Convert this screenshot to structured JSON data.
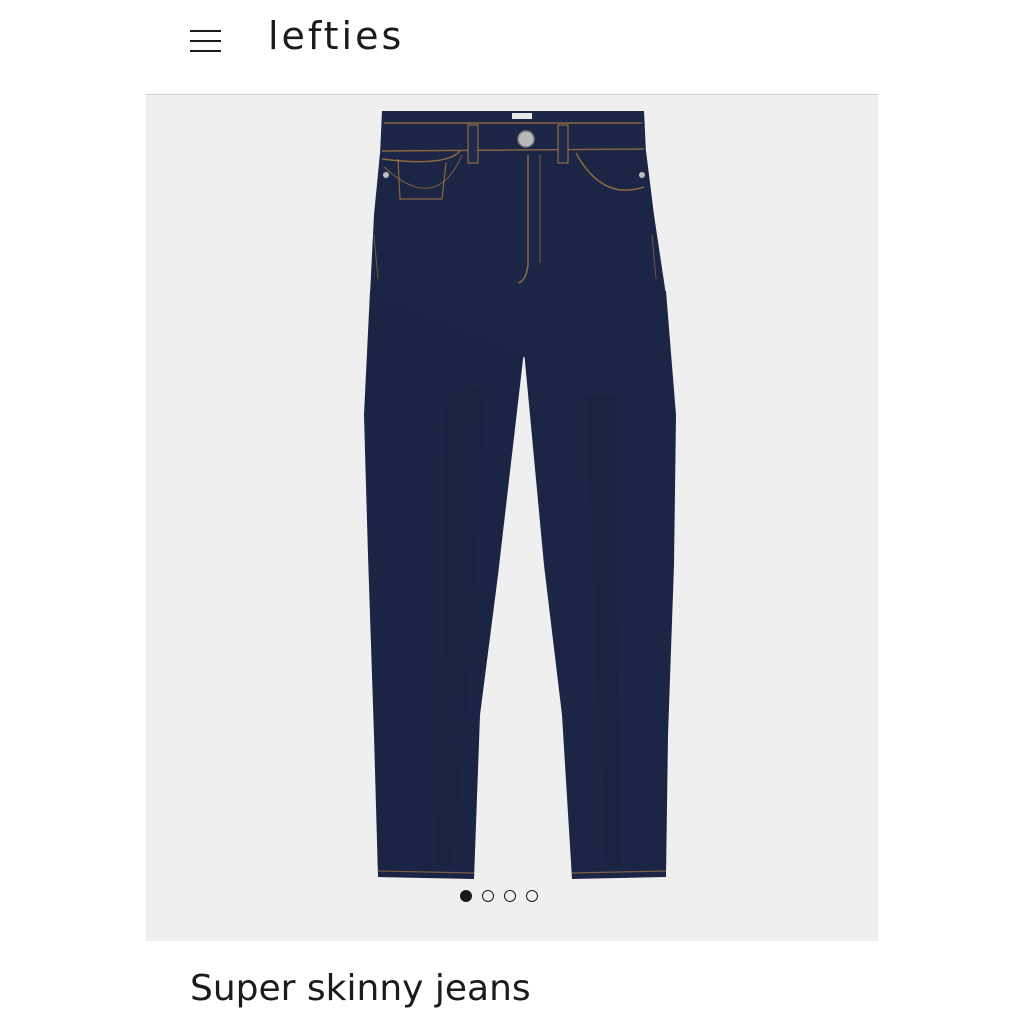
{
  "header": {
    "brand": "lefties",
    "menu_icon": "hamburger-menu-icon"
  },
  "gallery": {
    "image_alt": "Dark navy super skinny jeans",
    "image_subject": "jeans",
    "current_slide": 1,
    "total_slides": 4,
    "colors": {
      "background": "#efefef",
      "denim": "#1b2545",
      "stitching": "#b07a3a"
    }
  },
  "product": {
    "title": "Super skinny jeans"
  }
}
